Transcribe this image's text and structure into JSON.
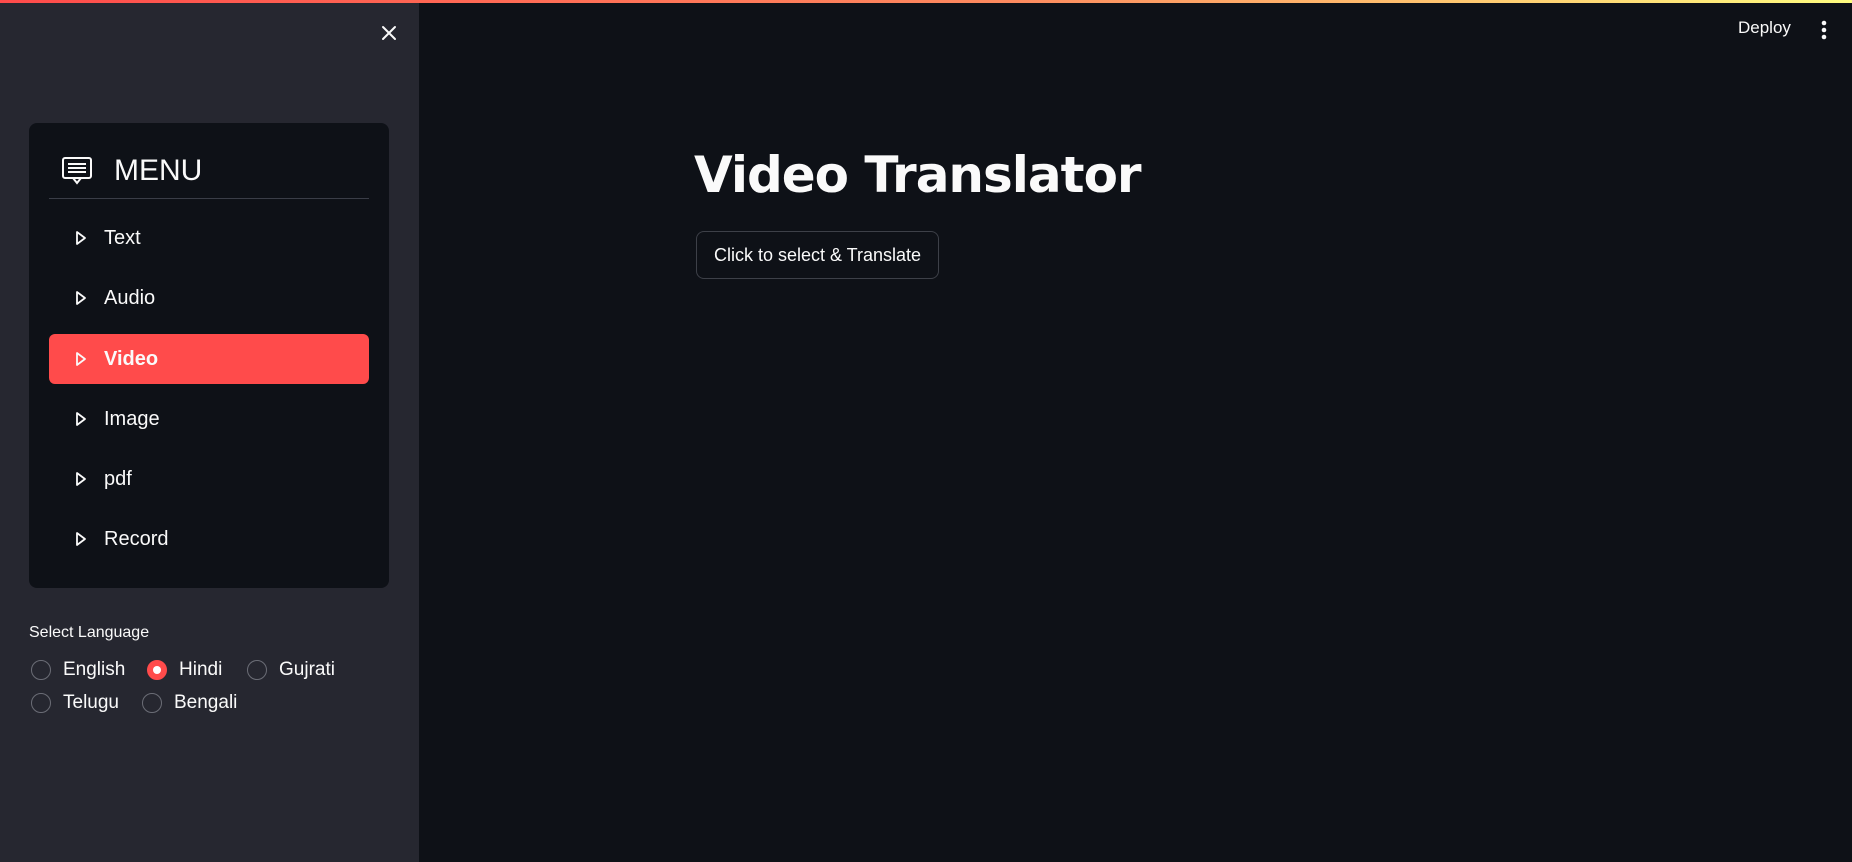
{
  "header": {
    "deploy_label": "Deploy"
  },
  "sidebar": {
    "menu_title": "MENU",
    "items": [
      {
        "label": "Text",
        "active": false
      },
      {
        "label": "Audio",
        "active": false
      },
      {
        "label": "Video",
        "active": true
      },
      {
        "label": "Image",
        "active": false
      },
      {
        "label": "pdf",
        "active": false
      },
      {
        "label": "Record",
        "active": false
      }
    ],
    "language_label": "Select Language",
    "languages": [
      {
        "label": "English",
        "checked": false
      },
      {
        "label": "Hindi",
        "checked": true
      },
      {
        "label": "Gujrati",
        "checked": false
      },
      {
        "label": "Telugu",
        "checked": false
      },
      {
        "label": "Bengali",
        "checked": false
      }
    ]
  },
  "main": {
    "title": "Video Translator",
    "button_label": "Click to select & Translate"
  },
  "colors": {
    "accent": "#ff4b4b",
    "background": "#0e1117",
    "sidebar": "#262730"
  }
}
